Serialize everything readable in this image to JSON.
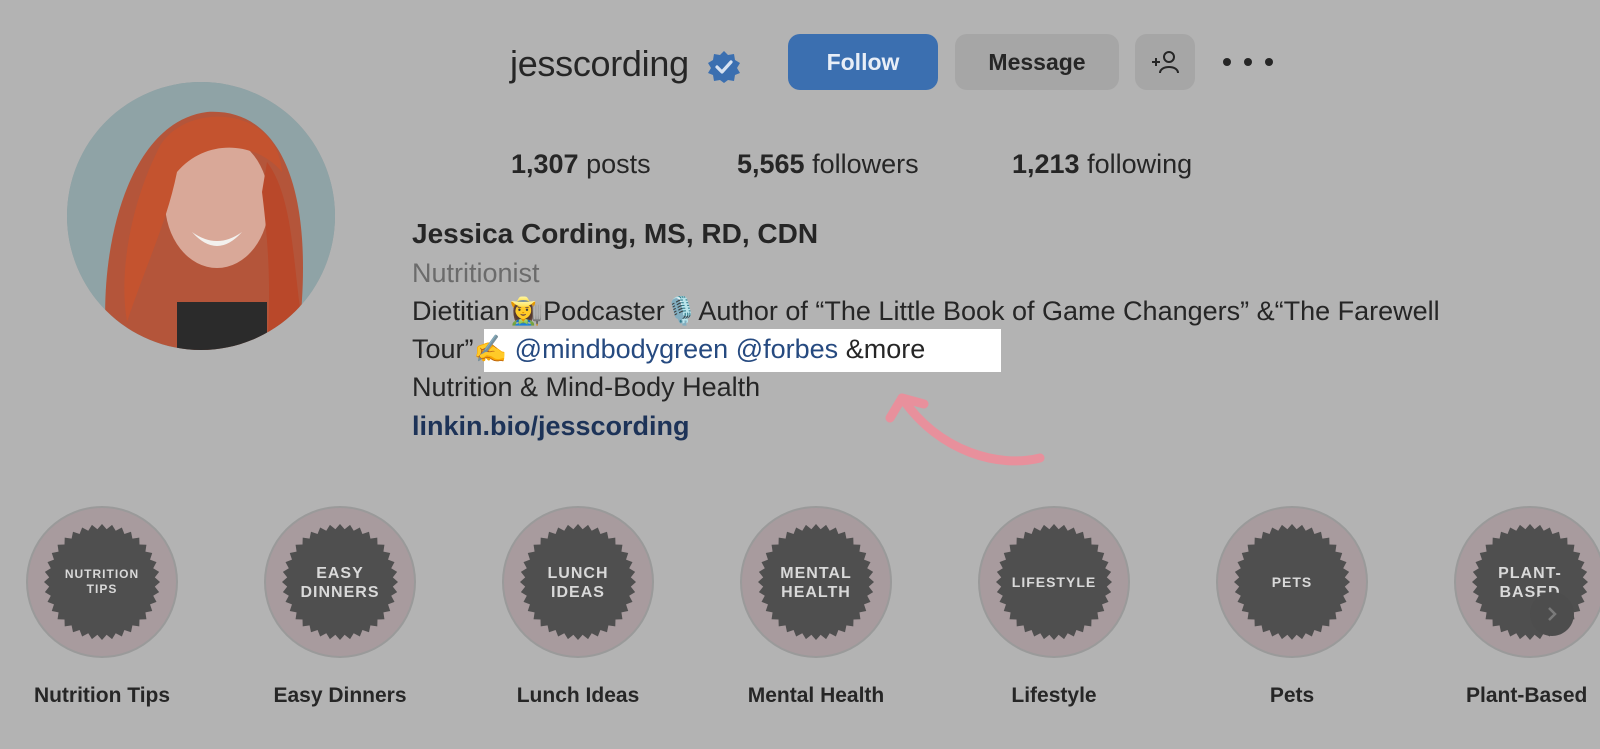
{
  "profile": {
    "username": "jesscording",
    "follow_label": "Follow",
    "message_label": "Message",
    "stats": {
      "posts_count": "1,307",
      "posts_label": "posts",
      "followers_count": "5,565",
      "followers_label": "followers",
      "following_count": "1,213",
      "following_label": "following"
    },
    "full_name": "Jessica Cording, MS, RD, CDN",
    "category": "Nutritionist",
    "bio": {
      "line1": "Dietitian👩‍🌾Podcaster🎙️Author of “The Little Book of Game Changers” &“The Farewell",
      "line2_prefix": "Tour”",
      "line2_emoji": "✍️",
      "mention1": "@mindbodygreen",
      "mention2": "@forbes",
      "line2_suffix": "&more",
      "line3": "Nutrition & Mind-Body Health"
    },
    "link": "linkin.bio/jesscording"
  },
  "highlights": [
    {
      "label": "Nutrition Tips",
      "cover": [
        "NUTRITION",
        "TIPS"
      ]
    },
    {
      "label": "Easy Dinners",
      "cover": [
        "EASY",
        "DINNERS"
      ]
    },
    {
      "label": "Lunch Ideas",
      "cover": [
        "LUNCH",
        "IDEAS"
      ]
    },
    {
      "label": "Mental Health",
      "cover": [
        "MENTAL",
        "HEALTH"
      ]
    },
    {
      "label": "Lifestyle",
      "cover": [
        "LIFESTYLE"
      ]
    },
    {
      "label": "Pets",
      "cover": [
        "PETS"
      ]
    },
    {
      "label": "Plant-Based",
      "cover": [
        "PLANT-",
        "BASED"
      ]
    }
  ],
  "icons": {
    "verified": "verified-badge-icon",
    "add_user": "add-user-icon",
    "more": "more-options-icon",
    "next": "chevron-right-icon"
  },
  "colors": {
    "follow_button": "#3b6fb0",
    "mention_link": "#264a80",
    "annotation_arrow": "#e8909c",
    "highlight_box": "#ffffff"
  }
}
